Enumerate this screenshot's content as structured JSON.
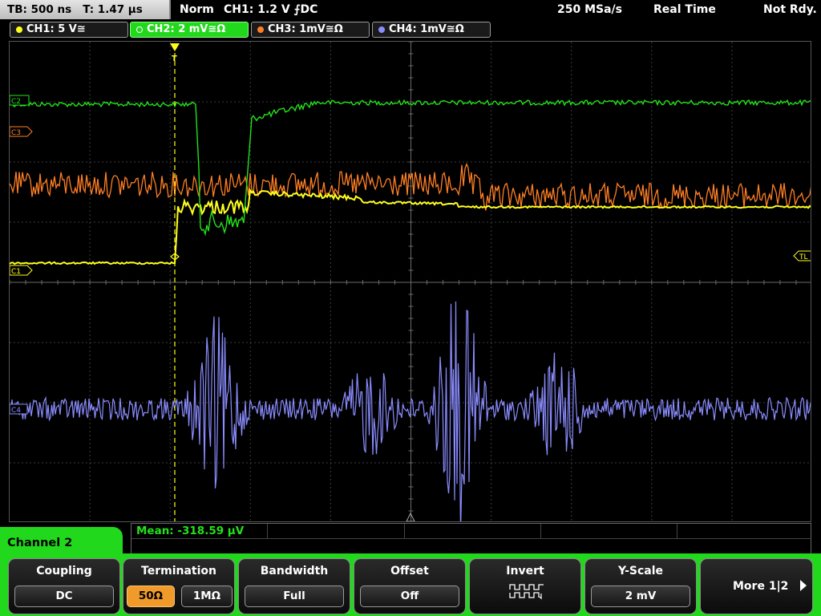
{
  "status": {
    "timebase": "TB: 500 ns",
    "trigger_time": "T: 1.47 µs",
    "acq_mode": "Norm",
    "trigger": "CH1: 1.2 V ⨍DC",
    "sample_rate": "250 MSa/s",
    "acq_type": "Real Time",
    "trigger_status": "Not Rdy."
  },
  "channels": [
    {
      "label": "CH1: 5 V≅",
      "color": "#ffff1e"
    },
    {
      "label": "CH2: 2 mV≅Ω",
      "color": "#22d81c"
    },
    {
      "label": "CH3: 1mV≅Ω",
      "color": "#ff7f24"
    },
    {
      "label": "CH4: 1mV≅Ω",
      "color": "#8a8cff"
    }
  ],
  "markers": {
    "ch2": "C2",
    "ch3": "C3",
    "ch1": "C1",
    "ch4": "C4",
    "trigger_level": "TL",
    "trigger_top": "T"
  },
  "measurement": {
    "mean": "Mean: -318.59 µV"
  },
  "panel": {
    "title": "Channel 2"
  },
  "softkeys": {
    "coupling": {
      "title": "Coupling",
      "value": "DC"
    },
    "termination": {
      "title": "Termination",
      "option_a": "50Ω",
      "option_b": "1MΩ"
    },
    "bandwidth": {
      "title": "Bandwidth",
      "value": "Full"
    },
    "offset": {
      "title": "Offset",
      "value": "Off"
    },
    "invert": {
      "title": "Invert",
      "icon": "invert-waveform-icon"
    },
    "yscale": {
      "title": "Y-Scale",
      "value": "2 mV"
    },
    "more": {
      "label": "More 1|2",
      "icon": "arrow-right-icon"
    }
  }
}
